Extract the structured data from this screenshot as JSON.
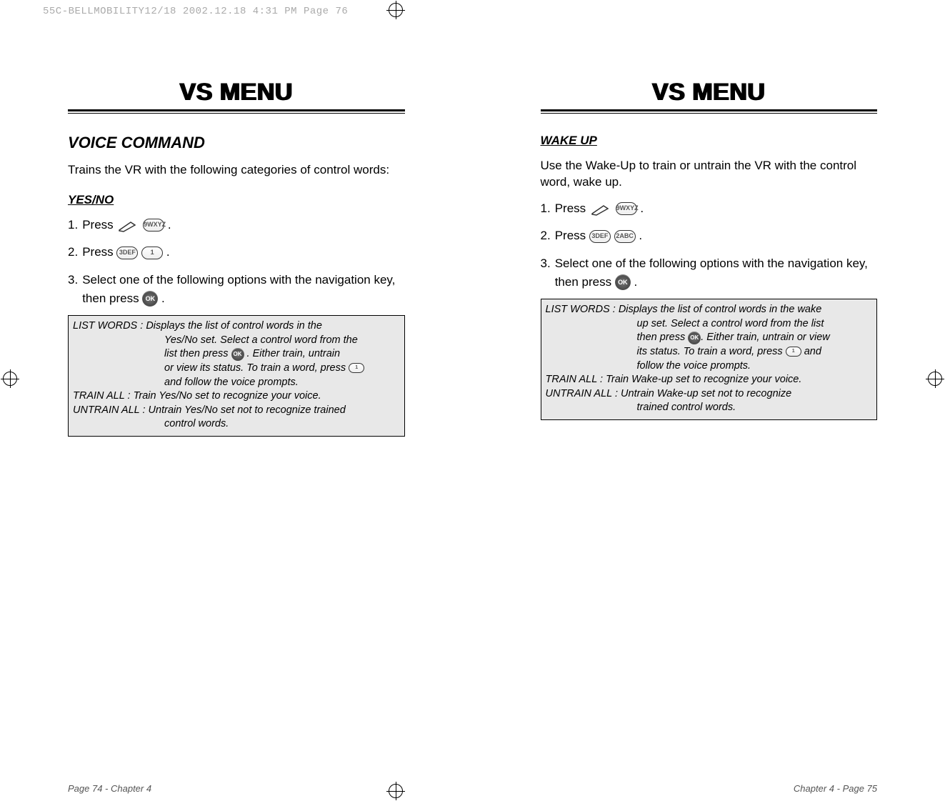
{
  "slug": "55C-BELLMOBILITY12/18  2002.12.18  4:31 PM  Page 76",
  "shared": {
    "menu_title": "VS MENU"
  },
  "left": {
    "section_head": "VOICE COMMAND",
    "intro": "Trains the VR with the following categories of control words:",
    "sub_head": "YES/NO",
    "steps": {
      "n1": "1.",
      "s1": "Press",
      "n2": "2.",
      "s2": "Press",
      "n3": "3.",
      "s3a": "Select one of the following options with the navigation key, then press",
      "period": "."
    },
    "keys": {
      "k1": "9WXYZ",
      "k2": "3DEF",
      "k3": "1"
    },
    "box": {
      "lw_label": "LIST WORDS :",
      "lw_1": "Displays the list of control words in the",
      "lw_2": "Yes/No set. Select a control word from the",
      "lw_3a": "list then press ",
      "lw_3b": " . Either train, untrain",
      "lw_4": "or view its status. To train a word, press ",
      "lw_5": "and follow the voice prompts.",
      "ta": "TRAIN ALL : Train Yes/No set to recognize your voice.",
      "ua1": "UNTRAIN ALL : Untrain Yes/No set not to recognize trained",
      "ua2": "control words."
    },
    "footer": "Page 74 - Chapter 4"
  },
  "right": {
    "sub_head": "WAKE UP",
    "intro": "Use the Wake-Up to train or untrain the VR with the control word, wake up.",
    "steps": {
      "n1": "1.",
      "s1": "Press",
      "n2": "2.",
      "s2": "Press",
      "n3": "3.",
      "s3a": "Select one of the following options with the navigation key, then press",
      "period": "."
    },
    "keys": {
      "k1": "9WXYZ",
      "k2": "3DEF",
      "k3": "2ABC",
      "k4": "1"
    },
    "box": {
      "lw_label": "LIST WORDS :",
      "lw_1": "Displays the list of control words in the wake",
      "lw_2": "up set. Select a control word from the list",
      "lw_3a": "then press ",
      "lw_3b": ". Either train, untrain or view",
      "lw_4a": "its status. To train a word, press ",
      "lw_4b": " and",
      "lw_5": "follow the voice prompts.",
      "ta": "TRAIN ALL : Train Wake-up set to recognize your voice.",
      "ua1": "UNTRAIN ALL : Untrain Wake-up set not to recognize",
      "ua2": "trained control words."
    },
    "footer": "Chapter 4 - Page 75"
  },
  "icons": {
    "ok": "OK"
  }
}
